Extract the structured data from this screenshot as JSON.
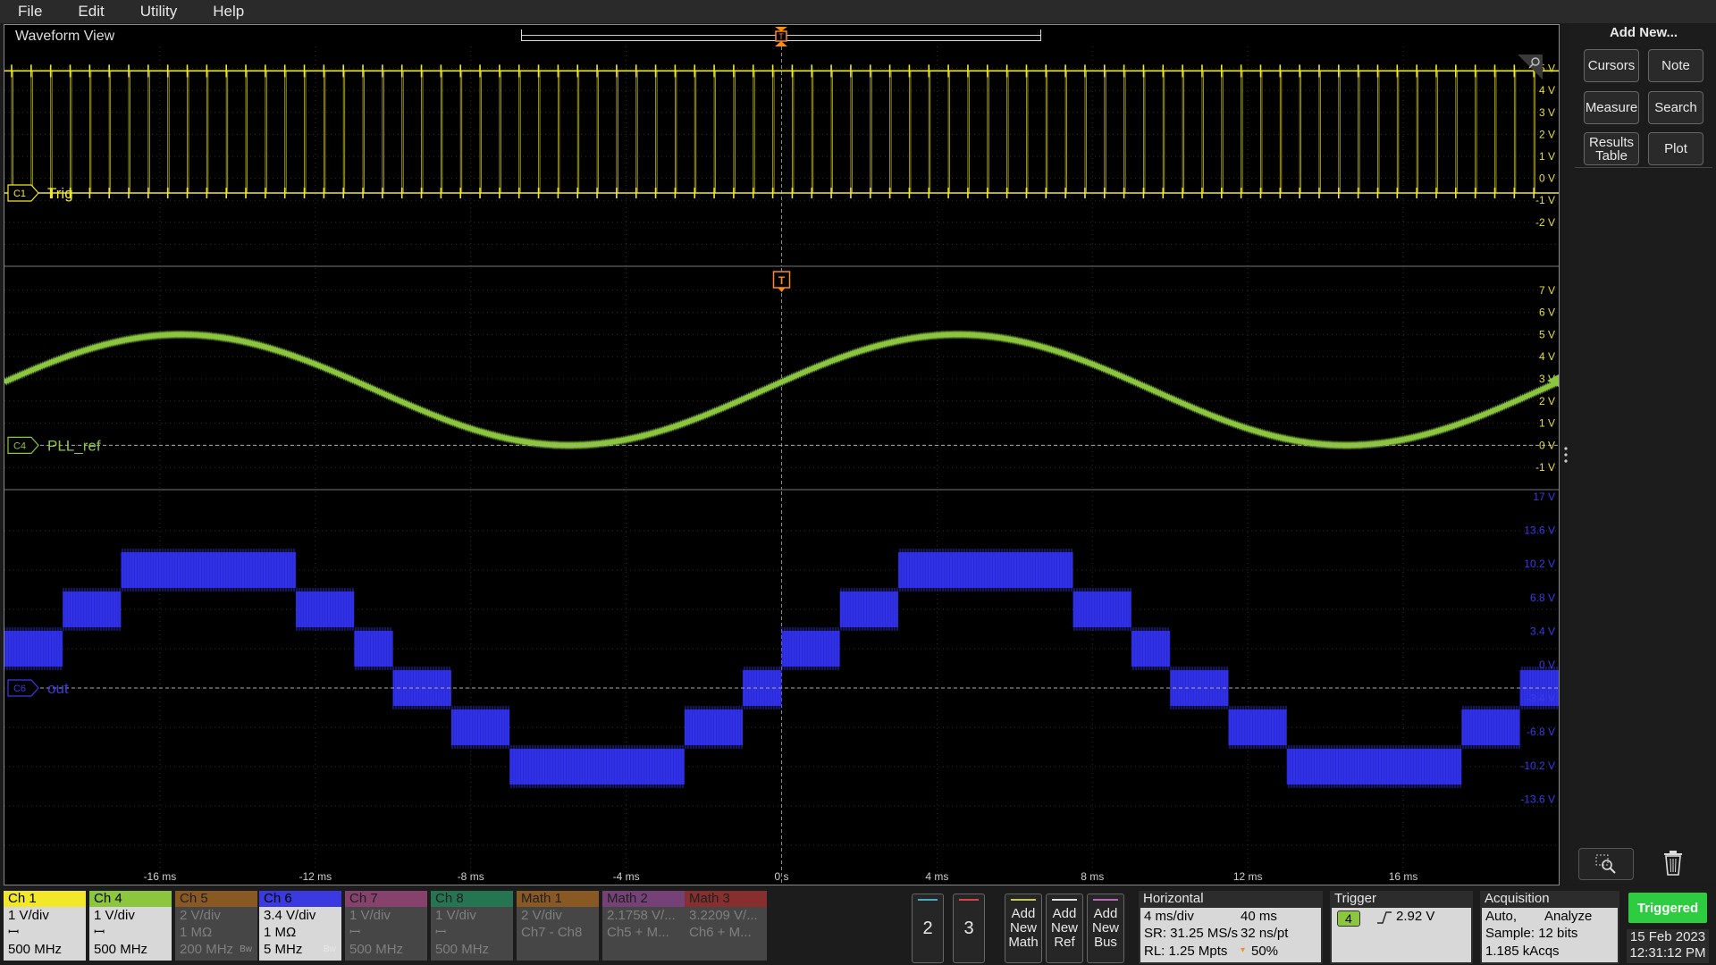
{
  "menu": [
    "File",
    "Edit",
    "Utility",
    "Help"
  ],
  "view": {
    "title": "Waveform View",
    "trigger_marker": "T"
  },
  "colors": {
    "ch1": "#f2e829",
    "ch4": "#8cc63f",
    "ch6": "#2b2bd6",
    "ch6_label": "#3a3ae0",
    "trigger": "#ff8c1a",
    "triggered": "#2ecc40"
  },
  "panel1": {
    "channel_tag": "C1",
    "label": "Trig",
    "y_labels": [
      "5 V",
      "4 V",
      "3 V",
      "2 V",
      "1 V",
      "0 V",
      "-1 V",
      "-2 V"
    ]
  },
  "panel2": {
    "channel_tag": "C4",
    "label": "PLL_ref",
    "trigger_tag": "T",
    "y_labels": [
      "7 V",
      "6 V",
      "5 V",
      "4 V",
      "3 V",
      "2 V",
      "1 V",
      "0 V",
      "-1 V"
    ]
  },
  "panel3": {
    "channel_tag": "C6",
    "label": "out",
    "y_labels": [
      "17 V",
      "13.6 V",
      "10.2 V",
      "6.8 V",
      "3.4 V",
      "0 V",
      "-3.4 V",
      "-6.8 V",
      "-10.2 V",
      "-13.6 V"
    ]
  },
  "x_axis": {
    "unit": "ms",
    "ticks": [
      {
        "value": -16,
        "label": "-16 ms"
      },
      {
        "value": -12,
        "label": "-12 ms"
      },
      {
        "value": -8,
        "label": "-8 ms"
      },
      {
        "value": -4,
        "label": "-4 ms"
      },
      {
        "value": 0,
        "label": "0 s"
      },
      {
        "value": 4,
        "label": "4 ms"
      },
      {
        "value": 8,
        "label": "8 ms"
      },
      {
        "value": 12,
        "label": "12 ms"
      },
      {
        "value": 16,
        "label": "16 ms"
      }
    ],
    "range": [
      -20,
      20
    ]
  },
  "chart_data": [
    {
      "type": "line",
      "series": [
        {
          "name": "Trig",
          "channel": "C1",
          "waveform": "pulse train",
          "low_v": 0,
          "high_v": 5,
          "pulse_count": 79
        }
      ],
      "x_range_ms": [
        -20,
        20
      ],
      "y_range_v": [
        -3,
        6
      ]
    },
    {
      "type": "line",
      "series": [
        {
          "name": "PLL_ref",
          "channel": "C4",
          "waveform": "sine",
          "offset_v": 2.5,
          "amplitude_v": 2.5,
          "period_ms": 20,
          "x_ms": [
            -20,
            -18,
            -16,
            -14,
            -12,
            -10,
            -8,
            -6,
            -4,
            -2,
            0,
            2,
            4,
            6,
            8,
            10,
            12,
            14,
            16,
            18,
            20
          ],
          "y_v": [
            1.0,
            2.0,
            4.0,
            5.0,
            4.5,
            3.1,
            2.0,
            0.5,
            0.0,
            1.0,
            2.5,
            4.0,
            5.0,
            4.5,
            3.1,
            2.0,
            0.5,
            0.0,
            1.0,
            2.5,
            3.0
          ]
        }
      ],
      "x_range_ms": [
        -20,
        20
      ],
      "y_range_v": [
        -2,
        8
      ]
    },
    {
      "type": "line",
      "series": [
        {
          "name": "out",
          "channel": "C6",
          "waveform": "staircase",
          "steps": [
            {
              "x0_ms": -20.0,
              "x1_ms": -18.5,
              "level_v": 3.4
            },
            {
              "x0_ms": -18.5,
              "x1_ms": -17.0,
              "level_v": 6.8
            },
            {
              "x0_ms": -17.0,
              "x1_ms": -12.5,
              "level_v": 10.2
            },
            {
              "x0_ms": -12.5,
              "x1_ms": -11.0,
              "level_v": 6.8
            },
            {
              "x0_ms": -11.0,
              "x1_ms": -10.0,
              "level_v": 3.4
            },
            {
              "x0_ms": -10.0,
              "x1_ms": -8.5,
              "level_v": 0
            },
            {
              "x0_ms": -8.5,
              "x1_ms": -7.0,
              "level_v": -3.4
            },
            {
              "x0_ms": -7.0,
              "x1_ms": -2.5,
              "level_v": -6.8
            },
            {
              "x0_ms": -2.5,
              "x1_ms": -1.0,
              "level_v": -3.4
            },
            {
              "x0_ms": -1.0,
              "x1_ms": 0.0,
              "level_v": 0
            },
            {
              "x0_ms": 0.0,
              "x1_ms": 1.5,
              "level_v": 3.4
            },
            {
              "x0_ms": 1.5,
              "x1_ms": 3.0,
              "level_v": 6.8
            },
            {
              "x0_ms": 3.0,
              "x1_ms": 7.5,
              "level_v": 10.2
            },
            {
              "x0_ms": 7.5,
              "x1_ms": 9.0,
              "level_v": 6.8
            },
            {
              "x0_ms": 9.0,
              "x1_ms": 10.0,
              "level_v": 3.4
            },
            {
              "x0_ms": 10.0,
              "x1_ms": 11.5,
              "level_v": 0
            },
            {
              "x0_ms": 11.5,
              "x1_ms": 13.0,
              "level_v": -3.4
            },
            {
              "x0_ms": 13.0,
              "x1_ms": 17.5,
              "level_v": -6.8
            },
            {
              "x0_ms": 17.5,
              "x1_ms": 19.0,
              "level_v": -3.4
            },
            {
              "x0_ms": 19.0,
              "x1_ms": 20.0,
              "level_v": 0
            }
          ]
        }
      ],
      "x_range_ms": [
        -20,
        20
      ],
      "y_range_v": [
        -17,
        17
      ]
    }
  ],
  "side_panel": {
    "title": "Add New...",
    "buttons": [
      "Cursors",
      "Note",
      "Measure",
      "Search",
      "Results Table",
      "Plot"
    ],
    "zoom_icon": "zoom-icon",
    "delete_icon": "trash-icon"
  },
  "channels": [
    {
      "name": "Ch 1",
      "line1": "1 V/div",
      "line2": "ꟷ",
      "line3": "500 MHz",
      "color": "#f2e829",
      "active": true
    },
    {
      "name": "Ch 4",
      "line1": "1 V/div",
      "line2": "ꟷ",
      "line3": "500 MHz",
      "color": "#8cc63f",
      "active": true
    },
    {
      "name": "Ch 5",
      "line1": "2 V/div",
      "line2": "1 MΩ",
      "line3": "200 MHz",
      "color": "#e58a2a",
      "active": false
    },
    {
      "name": "Ch 6",
      "line1": "3.4 V/div",
      "line2": "1 MΩ",
      "line3": "5 MHz",
      "color": "#3a3ae0",
      "active": true
    },
    {
      "name": "Ch 7",
      "line1": "1 V/div",
      "line2": "ꟷ",
      "line3": "500 MHz",
      "color": "#e060b0",
      "active": false
    },
    {
      "name": "Ch 8",
      "line1": "1 V/div",
      "line2": "ꟷ",
      "line3": "500 MHz",
      "color": "#2fbf7f",
      "active": false
    },
    {
      "name": "Math 1",
      "line1": "2 V/div",
      "line2": "Ch7 - Ch8",
      "line3": "",
      "color": "#e58a2a",
      "active": false
    },
    {
      "name": "Math 2",
      "line1": "2.1758 V/...",
      "line2": "Ch5 + M...",
      "line3": "",
      "color": "#c060c0",
      "active": false
    },
    {
      "name": "Math 3",
      "line1": "3.2209 V/...",
      "line2": "Ch6 + M...",
      "line3": "",
      "color": "#e04040",
      "active": false
    }
  ],
  "bw_marks": {
    "ch5": "Bw",
    "ch6": "Bw"
  },
  "waveviews": [
    {
      "label": "2",
      "color": "#3ab0d0"
    },
    {
      "label": "3",
      "color": "#e04040"
    }
  ],
  "add_buttons": [
    {
      "label": "Add New Math",
      "color": "#c8c850"
    },
    {
      "label": "Add New Ref",
      "color": "#dddddd"
    },
    {
      "label": "Add New Bus",
      "color": "#c060c0"
    }
  ],
  "horizontal": {
    "title": "Horizontal",
    "scale": "4 ms/div",
    "duration": "40 ms",
    "sr": "SR: 31.25 MS/s",
    "spacing": "32 ns/pt",
    "rl": "RL: 1.25 Mpts",
    "position": "50%"
  },
  "trigger": {
    "title": "Trigger",
    "source": "4",
    "slope_icon": "rising-edge-icon",
    "level": "2.92 V"
  },
  "acquisition": {
    "title": "Acquisition",
    "mode": "Auto,",
    "analyze": "Analyze",
    "sample": "Sample: 12 bits",
    "acqs": "1.185 kAcqs"
  },
  "status": {
    "state": "Triggered",
    "date": "15 Feb 2023",
    "time": "12:31:12 PM"
  }
}
